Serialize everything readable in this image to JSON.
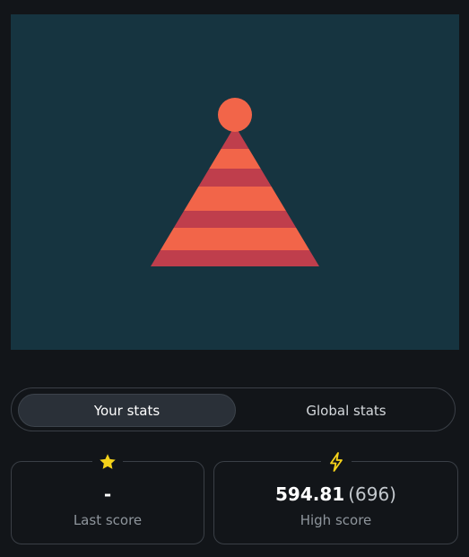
{
  "colors": {
    "background": "#121519",
    "canvas": "#163440",
    "hat_orange": "#f26549",
    "hat_red": "#bf3e4c",
    "star": "#f5d21a",
    "bolt": "#f5d21a"
  },
  "tabs": [
    {
      "label": "Your stats",
      "active": true
    },
    {
      "label": "Global stats",
      "active": false
    }
  ],
  "stats": {
    "last": {
      "icon": "star-icon",
      "value": "-",
      "label": "Last score"
    },
    "high": {
      "icon": "lightning-icon",
      "value": "594.81",
      "sub": "(696)",
      "label": "High score"
    }
  }
}
